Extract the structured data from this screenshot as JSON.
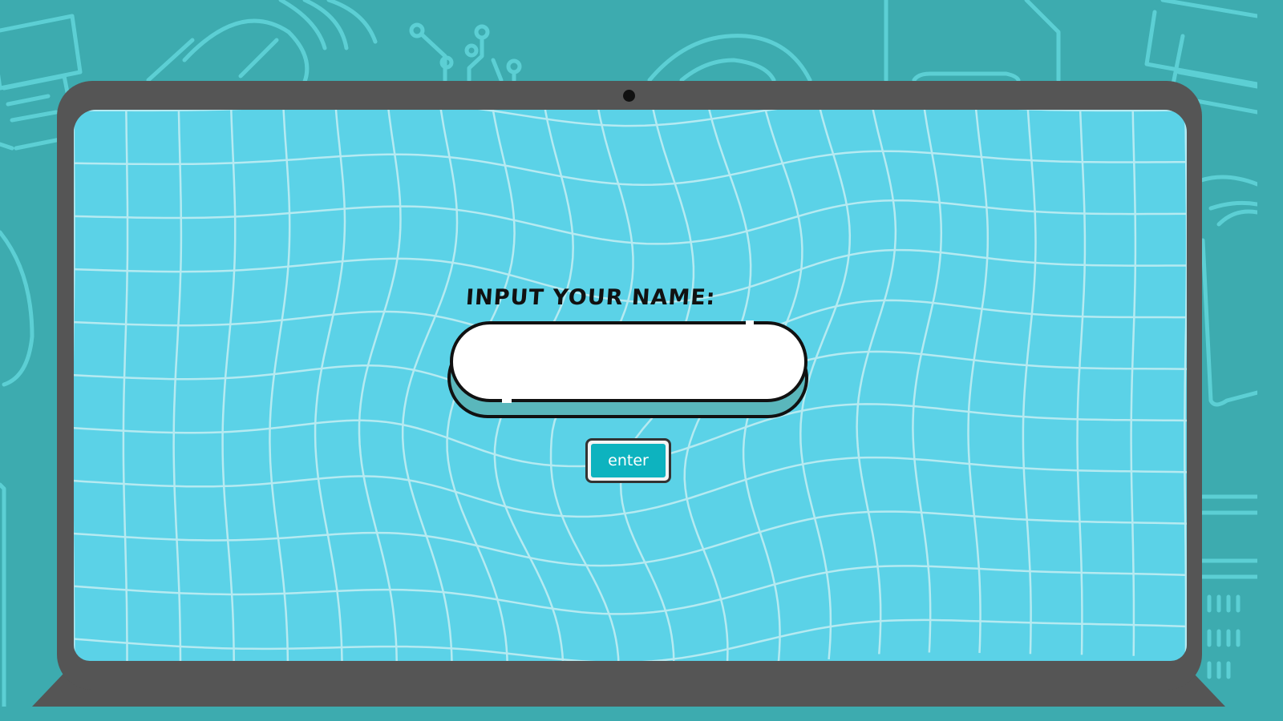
{
  "form": {
    "label": "INPUT YOUR NAME:",
    "name_input_value": "",
    "name_input_placeholder": "",
    "enter_label": "enter"
  },
  "colors": {
    "background": "#3DABAF",
    "doodle_line": "#5CCFD4",
    "laptop_frame": "#555555",
    "screen": "#5BD2E7",
    "grid_line": "#BFEDF3",
    "input_fill": "#FFFFFF",
    "input_shadow": "#5AB7BC",
    "button_fill": "#0DB3BF",
    "outline": "#111111"
  },
  "icons": {
    "background_doodles": [
      "printer-icon",
      "mouse-icon",
      "wifi-icon",
      "circuit-icon",
      "cd-disc-icon",
      "floppy-disk-icon",
      "monitor-icon",
      "server-rack-icon"
    ],
    "webcam": "webcam-icon"
  }
}
